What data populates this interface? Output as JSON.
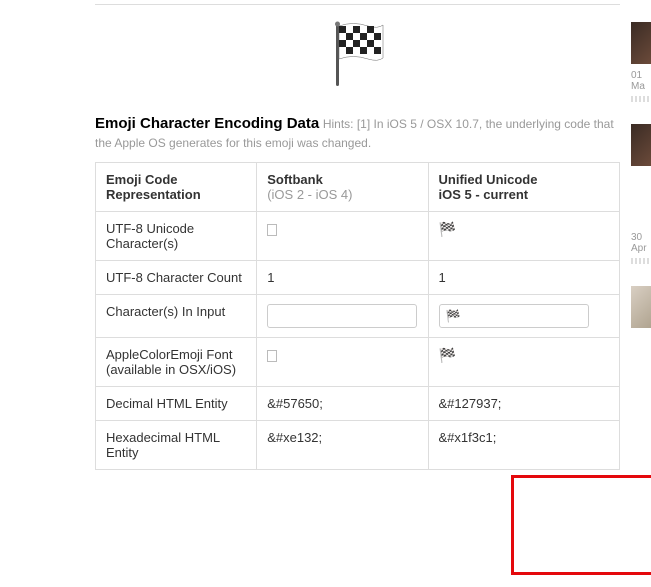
{
  "heading": {
    "title": "Emoji Character Encoding Data",
    "hint": "Hints: [1] In iOS 5 / OSX 10.7, the underlying code that the Apple OS generates for this emoji was changed."
  },
  "table": {
    "headers": {
      "col1": "Emoji Code Representation",
      "col2": {
        "main": "Softbank",
        "sub": "(iOS 2 - iOS 4)"
      },
      "col3": {
        "main": "Unified Unicode",
        "sub": "iOS 5 - current"
      }
    },
    "rows": [
      {
        "label": "UTF-8 Unicode Character(s)",
        "softbank_box": true,
        "unified_flag": true
      },
      {
        "label": "UTF-8 Character Count",
        "softbank": "1",
        "unified": "1"
      },
      {
        "label": "Character(s) In Input",
        "input_row": true,
        "softbank_value": "",
        "unified_value": "🏁"
      },
      {
        "label": "AppleColorEmoji Font (available in OSX/iOS)",
        "softbank_box": true,
        "unified_flag": true
      },
      {
        "label": "Decimal HTML Entity",
        "softbank": "&#57650;",
        "unified": "&#127937;"
      },
      {
        "label": "Hexadecimal HTML Entity",
        "softbank": "&#xe132;",
        "unified": "&#x1f3c1;"
      }
    ]
  },
  "sidebar": {
    "date1": "01 Ma",
    "date2": "30 Apr"
  }
}
